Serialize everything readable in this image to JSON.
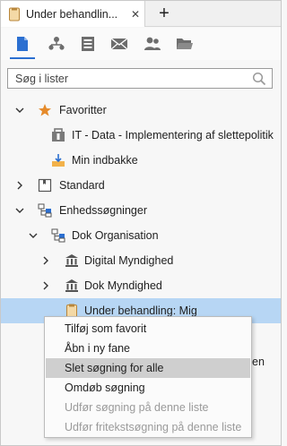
{
  "tab": {
    "title": "Under behandlin...",
    "close_glyph": "✕",
    "add_glyph": "+"
  },
  "toolbar": {
    "buttons": [
      {
        "icon": "document-icon",
        "active": true
      },
      {
        "icon": "org-chart-icon"
      },
      {
        "icon": "register-icon"
      },
      {
        "icon": "mail-icon"
      },
      {
        "icon": "people-icon"
      },
      {
        "icon": "folder-icon"
      }
    ]
  },
  "search": {
    "placeholder": "Søg i lister",
    "value": ""
  },
  "tree": {
    "favorites": {
      "label": "Favoritter"
    },
    "fav_item_1": {
      "label": "IT - Data - Implementering af slettepolitik"
    },
    "fav_item_2": {
      "label": "Min indbakke"
    },
    "standard": {
      "label": "Standard"
    },
    "unit_searches": {
      "label": "Enhedssøgninger"
    },
    "dok_org": {
      "label": "Dok Organisation"
    },
    "digital": {
      "label": "Digital Myndighed"
    },
    "dok_myndighed": {
      "label": "Dok Myndighed"
    },
    "under_behandling": {
      "label": "Under behandling: Mig"
    }
  },
  "behind_text": "en",
  "context_menu": {
    "items": [
      {
        "label": "Tilføj som favorit",
        "state": "normal"
      },
      {
        "label": "Åbn i ny fane",
        "state": "normal"
      },
      {
        "label": "Slet søgning for alle",
        "state": "highlighted"
      },
      {
        "label": "Omdøb søgning",
        "state": "normal"
      },
      {
        "label": "Udfør søgning på denne liste",
        "state": "disabled"
      },
      {
        "label": "Udfør fritekstsøgning på denne liste",
        "state": "disabled"
      }
    ]
  },
  "colors": {
    "accent": "#2b6fd1",
    "selection": "#b7d6f4",
    "menu_highlight": "#cfcfcf",
    "star": "#e58a2a"
  }
}
